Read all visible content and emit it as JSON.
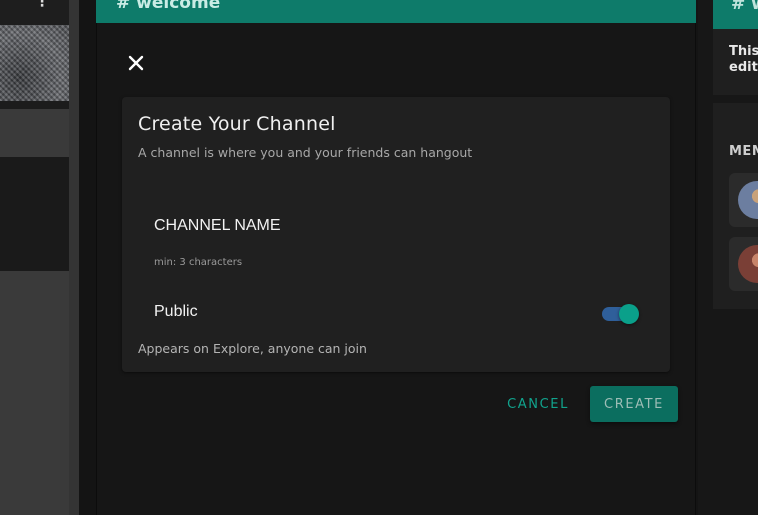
{
  "background": {
    "channel_header": "# welcome",
    "right_header": "# w",
    "right_description_lines": [
      "This",
      "edit"
    ],
    "members_title": "MEM",
    "left_menu_icon": "kebab-icon"
  },
  "modal": {
    "close_icon": "close-icon",
    "title": "Create Your Channel",
    "subtitle": "A channel is where you and your friends can hangout",
    "name_field": {
      "placeholder": "CHANNEL NAME",
      "value": "",
      "hint": "min: 3 characters"
    },
    "public_toggle": {
      "label": "Public",
      "enabled": true,
      "description": "Appears on Explore, anyone can join"
    },
    "cancel_label": "CANCEL",
    "create_label": "CREATE"
  },
  "colors": {
    "accent": "#0e7b6a",
    "toggle_thumb": "#0aa08a",
    "toggle_track": "#2f5f9a",
    "cancel_text": "#11a38d",
    "create_button": "#0b6e5f"
  }
}
